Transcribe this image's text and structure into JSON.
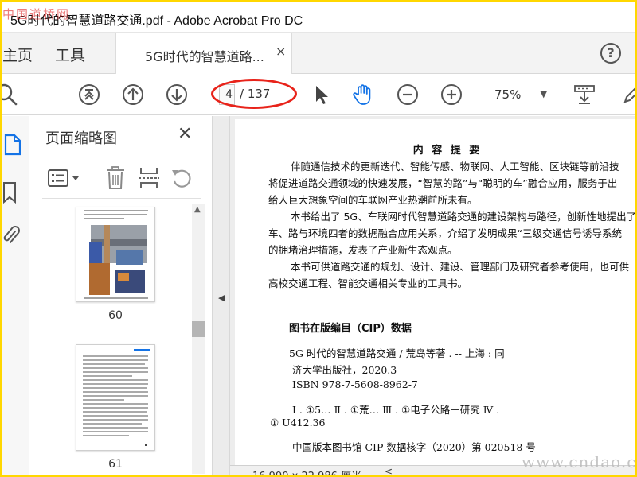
{
  "window": {
    "title": "5G时代的智慧道路交通.pdf - Adobe Acrobat Pro DC",
    "watermark_top_left": "中国道桥网"
  },
  "tabs": {
    "home": "主页",
    "tools": "工具",
    "document": "5G时代的智慧道路...",
    "close_glyph": "×",
    "help_glyph": "?"
  },
  "toolbar": {
    "current_page": "4",
    "total_pages": "/ 137",
    "zoom": "75%",
    "icons": [
      "search-icon",
      "first-page-icon",
      "prev-page-icon",
      "next-page-icon",
      "select-arrow-icon",
      "hand-icon",
      "zoom-out-icon",
      "zoom-in-icon",
      "zoom-dropdown-icon",
      "scroll-mode-icon",
      "pen-icon"
    ]
  },
  "thumbnails_panel": {
    "title": "页面缩略图",
    "close_glyph": "✕",
    "pages": [
      {
        "label": "60"
      },
      {
        "label": "61"
      }
    ]
  },
  "document": {
    "heading": "内 容 提 要",
    "paragraphs": [
      "伴随通信技术的更新迭代、智能传感、物联网、人工智能、区块链等前沿技",
      "将促进道路交通领域的快速发展，“智慧的路”与“聪明的车”融合应用，服务于出",
      "给人巨大想象空间的车联网产业热潮前所未有。",
      "本书给出了 5G、车联网时代智慧道路交通的建设架构与路径，创新性地提出了",
      "车、路与环境四者的数据融合应用关系，介绍了发明成果“三级交通信号诱导系统",
      "的拥堵治理措施，发表了产业新生态观点。",
      "本书可供道路交通的规划、设计、建设、管理部门及研究者参考使用，也可供",
      "高校交通工程、智能交通相关专业的工具书。"
    ],
    "cip_title": "图书在版编目（CIP）数据",
    "cip_lines": [
      "5G 时代的智慧道路交通 / 荒岛等著 . -- 上海 : 同",
      "济大学出版社，2020.3",
      "ISBN 978-7-5608-8962-7",
      "Ⅰ . ①5… Ⅱ . ①荒… Ⅲ . ①电子公路－研究 Ⅳ .",
      "① U412.36",
      "中国版本图书馆 CIP 数据核字（2020）第 020518 号"
    ]
  },
  "status": {
    "page_size": "16.990 x 22.986 厘米"
  },
  "watermark_bottom_right": "www.cndao.com",
  "colors": {
    "accent_blue": "#1473e6",
    "annotation_red": "#e8231a",
    "frame_yellow": "#ffd700"
  }
}
